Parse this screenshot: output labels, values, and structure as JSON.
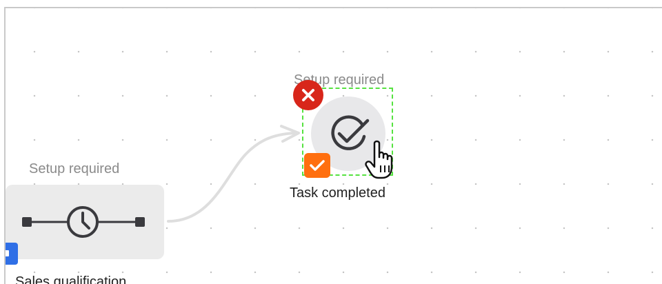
{
  "nodes": {
    "timer": {
      "status": "Setup required",
      "caption": "Sales qualification",
      "icon": "timer-delay-icon"
    },
    "task": {
      "status": "Setup required",
      "caption": "Task completed",
      "icon": "check-circle-icon",
      "selected": true
    }
  },
  "badges": {
    "delete": {
      "icon": "close-icon",
      "color": "#d8261a"
    },
    "complete": {
      "icon": "checkmark-icon",
      "color": "#ff6f0f"
    }
  },
  "colors": {
    "selection_outline": "#55e23f",
    "node_background": "#ebebeb",
    "connector": "#dedede",
    "handle": "#2f6fe6"
  },
  "cursor": "hand-pointer-icon"
}
